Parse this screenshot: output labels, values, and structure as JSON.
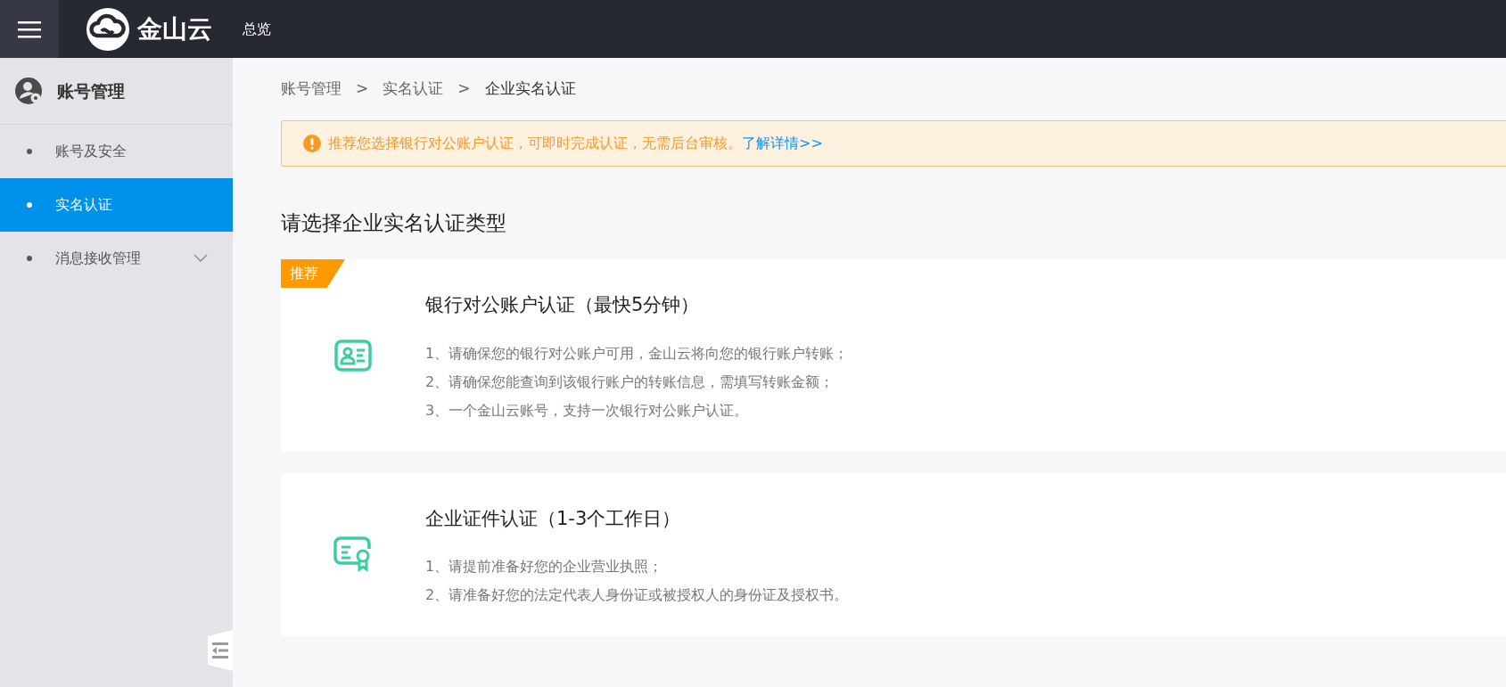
{
  "header": {
    "brand": "金山云",
    "nav": "总览"
  },
  "sidebar": {
    "title": "账号管理",
    "items": [
      {
        "label": "账号及安全",
        "selected": false,
        "kind": "link"
      },
      {
        "label": "实名认证",
        "selected": true,
        "kind": "link"
      },
      {
        "label": "消息接收管理",
        "selected": false,
        "kind": "group"
      }
    ]
  },
  "breadcrumb": [
    "账号管理",
    "实名认证",
    "企业实名认证"
  ],
  "breadcrumb_separators": [
    ">",
    ">"
  ],
  "alert": {
    "text": "推荐您选择银行对公账户认证，可即时完成认证，无需后台审核。",
    "link": "了解详情>>"
  },
  "heading": "请选择企业实名认证类型",
  "options": [
    {
      "badge": "推荐",
      "title": "银行对公账户认证（最快5分钟）",
      "lines": [
        "1、请确保您的银行对公账户可用，金山云将向您的银行账户转账；",
        "2、请确保您能查询到该银行账户的转账信息，需填写转账金额；",
        "3、一个金山云账号，支持一次银行对公账户认证。"
      ]
    },
    {
      "title": "企业证件认证（1-3个工作日）",
      "lines": [
        "1、请提前准备好您的企业营业执照；",
        "2、请准备好您的法定代表人身份证或被授权人的身份证及授权书。"
      ]
    }
  ]
}
